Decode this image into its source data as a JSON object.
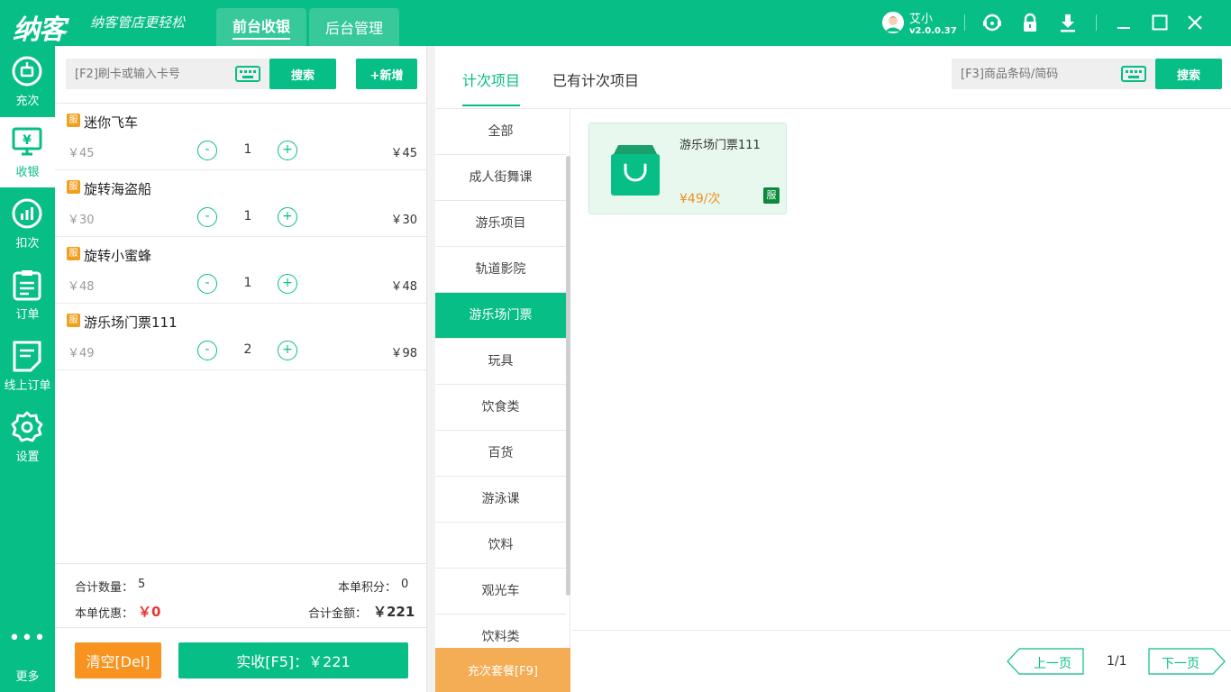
{
  "app": {
    "logo": "纳客",
    "slogan": "纳客管店更轻松",
    "tabs": [
      {
        "label": "前台收银",
        "active": true
      },
      {
        "label": "后台管理",
        "active": false
      }
    ],
    "user": {
      "name": "艾小",
      "version": "v2.0.0.37"
    },
    "top_icons": [
      "support-icon",
      "lock-icon",
      "download-icon",
      "minimize-icon",
      "maximize-icon",
      "close-icon"
    ]
  },
  "nav": [
    {
      "label": "充次",
      "icon": "recharge-icon",
      "active": false
    },
    {
      "label": "收银",
      "icon": "cashier-icon",
      "active": true
    },
    {
      "label": "扣次",
      "icon": "deduct-icon",
      "active": false
    },
    {
      "label": "订单",
      "icon": "order-icon",
      "active": false
    },
    {
      "label": "线上订单",
      "icon": "online-order-icon",
      "active": false
    },
    {
      "label": "设置",
      "icon": "settings-icon",
      "active": false
    },
    {
      "label": "更多",
      "icon": "more-icon",
      "active": false
    }
  ],
  "cart": {
    "search_placeholder": "[F2]刷卡或输入卡号",
    "search_button": "搜索",
    "add_button": "+新增",
    "items": [
      {
        "badge": "服",
        "name": "迷你飞车",
        "price": "￥45",
        "qty": "1",
        "total": "￥45"
      },
      {
        "badge": "服",
        "name": "旋转海盗船",
        "price": "￥30",
        "qty": "1",
        "total": "￥30"
      },
      {
        "badge": "服",
        "name": "旋转小蜜蜂",
        "price": "￥48",
        "qty": "1",
        "total": "￥48"
      },
      {
        "badge": "服",
        "name": "游乐场门票111",
        "price": "￥49",
        "qty": "2",
        "total": "￥98"
      }
    ],
    "minus": "-",
    "plus": "+",
    "summary": {
      "count_label": "合计数量：",
      "count_value": "5",
      "points_label": "本单积分：",
      "points_value": "0",
      "discount_label": "本单优惠：",
      "discount_value": "￥0",
      "total_label": "合计金额：",
      "total_value": "￥221"
    },
    "clear_button": "清空[Del]",
    "pay_button": "实收[F5]：￥221"
  },
  "products": {
    "tabs": [
      {
        "label": "计次项目",
        "active": true
      },
      {
        "label": "已有计次项目",
        "active": false
      }
    ],
    "search_placeholder": "[F3]商品条码/简码",
    "search_button": "搜索",
    "categories": [
      {
        "label": "全部",
        "active": false
      },
      {
        "label": "成人街舞课",
        "active": false
      },
      {
        "label": "游乐项目",
        "active": false
      },
      {
        "label": "轨道影院",
        "active": false
      },
      {
        "label": "游乐场门票",
        "active": true
      },
      {
        "label": "玩具",
        "active": false
      },
      {
        "label": "饮食类",
        "active": false
      },
      {
        "label": "百货",
        "active": false
      },
      {
        "label": "游泳课",
        "active": false
      },
      {
        "label": "饮料",
        "active": false
      },
      {
        "label": "观光车",
        "active": false
      },
      {
        "label": "饮料类",
        "active": false
      }
    ],
    "package_button": "充次套餐[F9]",
    "cards": [
      {
        "name": "游乐场门票111",
        "price": "¥49/次",
        "badge": "服",
        "icon": "shopping-bag-icon"
      }
    ],
    "pager": {
      "prev": "上一页",
      "page": "1/1",
      "next": "下一页"
    }
  },
  "colors": {
    "accent": "#07be86",
    "orange": "#f7931e",
    "badge": "#f0a020",
    "price": "#f0901e"
  }
}
